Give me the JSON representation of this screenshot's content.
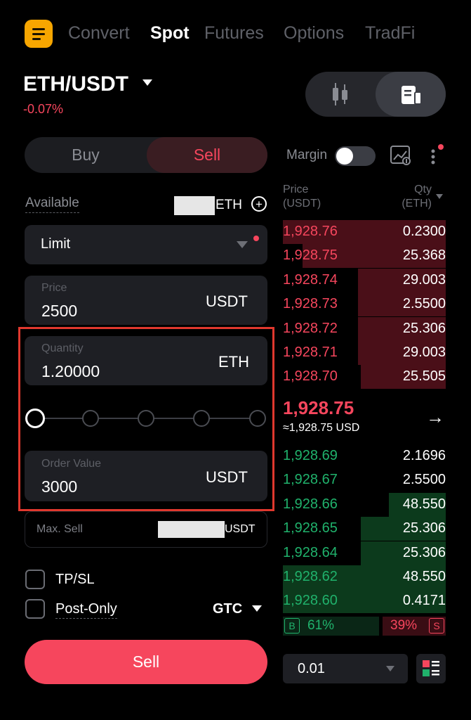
{
  "nav": {
    "tabs": [
      {
        "label": "Convert",
        "active": false
      },
      {
        "label": "Spot",
        "active": true
      },
      {
        "label": "Futures",
        "active": false
      },
      {
        "label": "Options",
        "active": false
      },
      {
        "label": "TradFi",
        "active": false
      }
    ]
  },
  "pair": {
    "symbol": "ETH/USDT",
    "change": "-0.07%",
    "change_color": "#f6465d"
  },
  "view_toggle": {
    "options": [
      "candlestick-chart-icon",
      "order-book-icon"
    ],
    "selected": "order-book-icon"
  },
  "trade_side": {
    "buy_label": "Buy",
    "sell_label": "Sell",
    "selected": "Sell"
  },
  "available": {
    "label": "Available",
    "unit": "ETH"
  },
  "order_type": {
    "value": "Limit"
  },
  "price": {
    "label": "Price",
    "value": "2500",
    "unit": "USDT"
  },
  "quantity": {
    "label": "Quantity",
    "value": "1.20000",
    "unit": "ETH"
  },
  "slider": {
    "steps": 5,
    "selected_index": 0
  },
  "order_value": {
    "label": "Order Value",
    "value": "3000",
    "unit": "USDT"
  },
  "max_sell": {
    "label": "Max. Sell",
    "unit": "USDT"
  },
  "options": {
    "tpsl_label": "TP/SL",
    "postonly_label": "Post-Only",
    "tif": "GTC"
  },
  "submit": {
    "label": "Sell"
  },
  "margin": {
    "label": "Margin",
    "enabled": false
  },
  "orderbook": {
    "price_header": "Price",
    "price_unit": "(USDT)",
    "qty_header": "Qty",
    "qty_unit": "(ETH)",
    "asks": [
      {
        "price": "1,928.76",
        "qty": "0.2300",
        "depth": 1.0
      },
      {
        "price": "1,928.75",
        "qty": "25.368",
        "depth": 0.88
      },
      {
        "price": "1,928.74",
        "qty": "29.003",
        "depth": 0.54
      },
      {
        "price": "1,928.73",
        "qty": "2.5500",
        "depth": 0.54
      },
      {
        "price": "1,928.72",
        "qty": "25.306",
        "depth": 0.54
      },
      {
        "price": "1,928.71",
        "qty": "29.003",
        "depth": 0.54
      },
      {
        "price": "1,928.70",
        "qty": "25.505",
        "depth": 0.52
      }
    ],
    "last_price": "1,928.75",
    "last_price_usd": "≈1,928.75 USD",
    "bids": [
      {
        "price": "1,928.69",
        "qty": "2.1696",
        "depth": 0.0
      },
      {
        "price": "1,928.67",
        "qty": "2.5500",
        "depth": 0.0
      },
      {
        "price": "1,928.66",
        "qty": "48.550",
        "depth": 0.35
      },
      {
        "price": "1,928.65",
        "qty": "25.306",
        "depth": 0.52
      },
      {
        "price": "1,928.64",
        "qty": "25.306",
        "depth": 0.52
      },
      {
        "price": "1,928.62",
        "qty": "48.550",
        "depth": 1.0
      },
      {
        "price": "1,928.60",
        "qty": "0.4171",
        "depth": 1.0
      }
    ],
    "buy_badge": "B",
    "buy_ratio": "61%",
    "sell_ratio": "39%",
    "sell_badge": "S",
    "tick_size": "0.01"
  }
}
